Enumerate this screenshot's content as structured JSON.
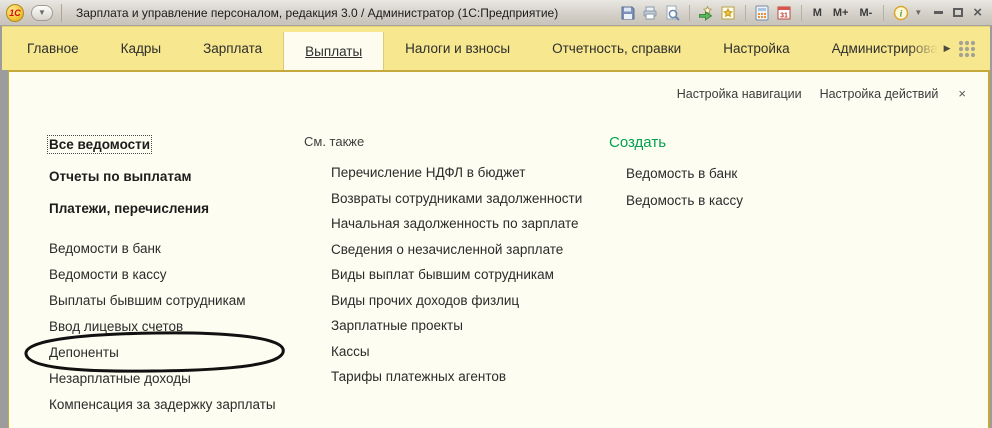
{
  "window": {
    "logo": "1С",
    "title": "Зарплата и управление персоналом, редакция 3.0 / Администратор  (1С:Предприятие)",
    "memory_buttons": [
      "M",
      "M+",
      "M-"
    ],
    "dropdown_glyph": "▼",
    "info_caret": "▼"
  },
  "tabs": {
    "items": [
      "Главное",
      "Кадры",
      "Зарплата",
      "Выплаты",
      "Налоги и взносы",
      "Отчетность, справки",
      "Настройка",
      "Администрирован"
    ],
    "active": "Выплаты",
    "overflow_arrow": "▶"
  },
  "panel": {
    "nav_settings": "Настройка навигации",
    "actions_settings": "Настройка действий",
    "close": "×",
    "primary": [
      "Все ведомости",
      "Отчеты по выплатам",
      "Платежи, перечисления"
    ],
    "items": [
      "Ведомости в банк",
      "Ведомости в кассу",
      "Выплаты бывшим сотрудникам",
      "Ввод лицевых счетов",
      "Депоненты",
      "Незарплатные доходы",
      "Компенсация за задержку зарплаты"
    ],
    "see_also": {
      "header": "См. также",
      "items": [
        "Перечисление НДФЛ в бюджет",
        "Возвраты сотрудниками задолженности",
        "Начальная задолженность по зарплате",
        "Сведения о незачисленной зарплате",
        "Виды выплат бывшим сотрудникам",
        "Виды прочих доходов физлиц",
        "Зарплатные проекты",
        "Кассы",
        "Тарифы платежных агентов"
      ]
    },
    "create": {
      "header": "Создать",
      "items": [
        "Ведомость в банк",
        "Ведомость в кассу"
      ]
    }
  },
  "colors": {
    "tab_bar": "#f7e78e",
    "tab_active": "#fdfcee",
    "panel_bg": "#fdfdf1",
    "border_gold": "#c5a93c",
    "create_green": "#00a150",
    "calendar_red": "#d9534f",
    "logo_red": "#cc1111"
  }
}
